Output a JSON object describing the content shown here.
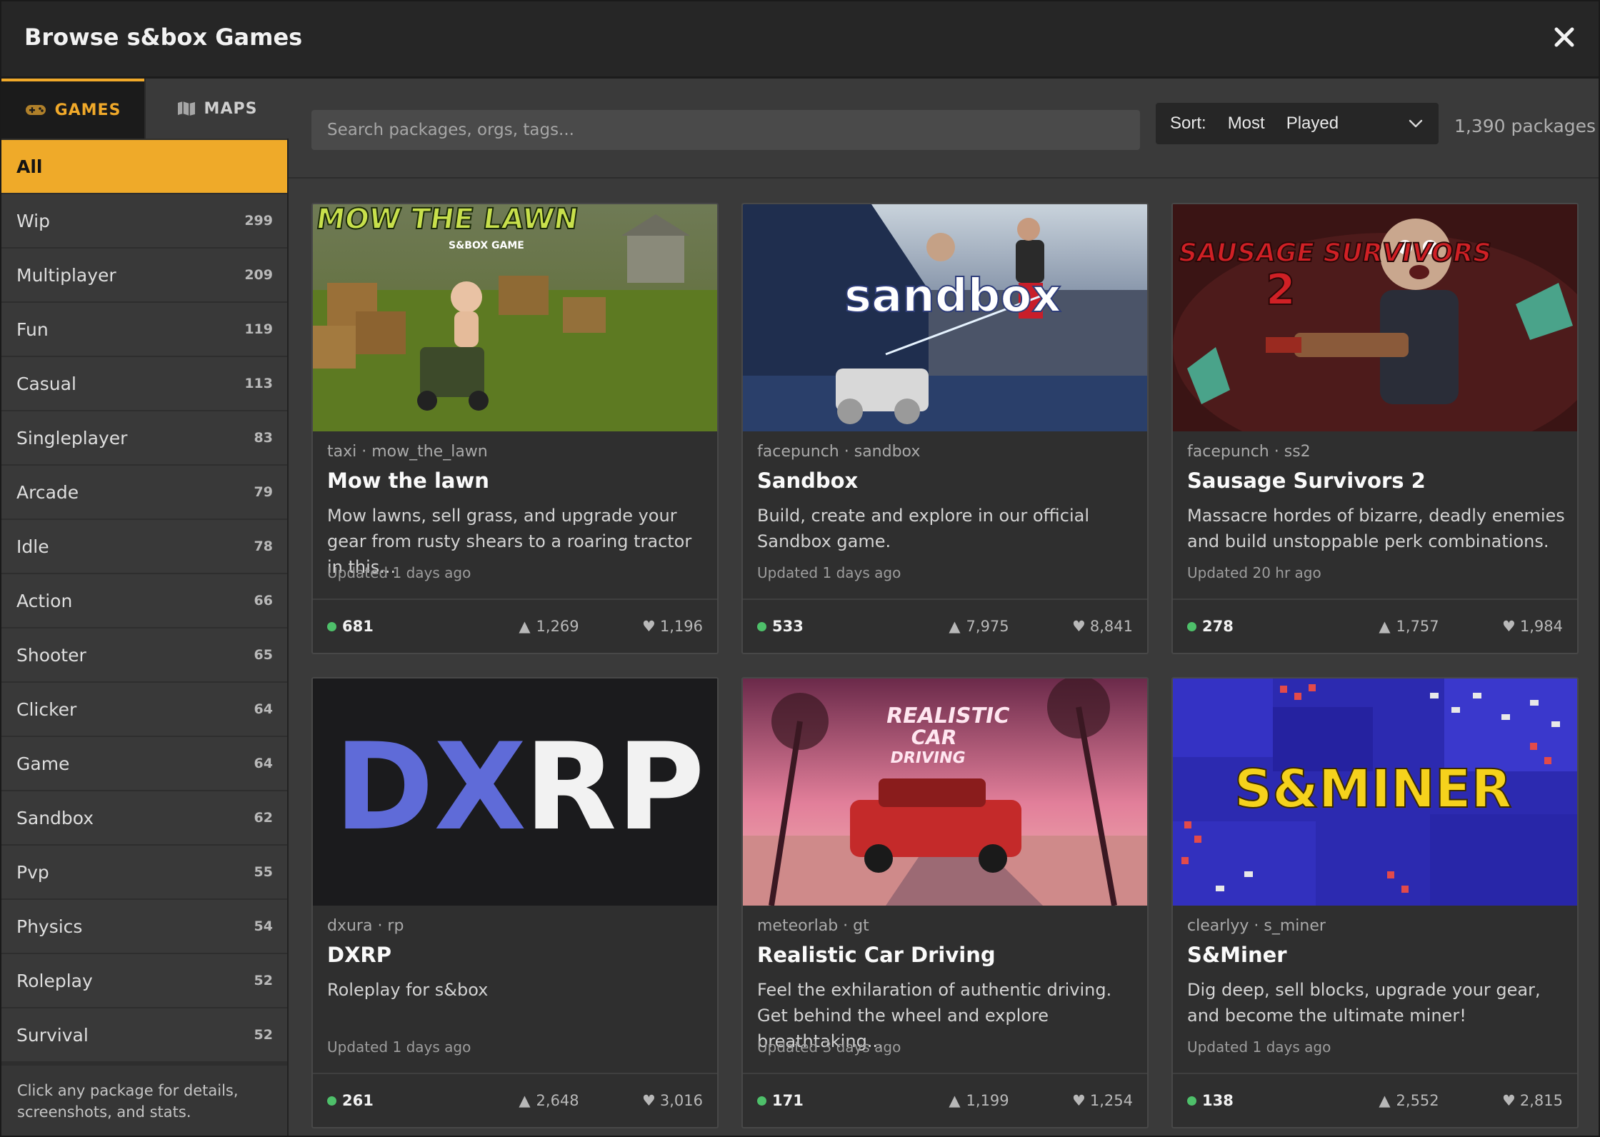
{
  "window": {
    "title": "Browse s&box Games"
  },
  "tabs": [
    {
      "label": "GAMES",
      "icon": "gamepad-icon"
    },
    {
      "label": "MAPS",
      "icon": "map-icon"
    }
  ],
  "categories": [
    {
      "label": "All",
      "count": ""
    },
    {
      "label": "Wip",
      "count": "299"
    },
    {
      "label": "Multiplayer",
      "count": "209"
    },
    {
      "label": "Fun",
      "count": "119"
    },
    {
      "label": "Casual",
      "count": "113"
    },
    {
      "label": "Singleplayer",
      "count": "83"
    },
    {
      "label": "Arcade",
      "count": "79"
    },
    {
      "label": "Idle",
      "count": "78"
    },
    {
      "label": "Action",
      "count": "66"
    },
    {
      "label": "Shooter",
      "count": "65"
    },
    {
      "label": "Clicker",
      "count": "64"
    },
    {
      "label": "Game",
      "count": "64"
    },
    {
      "label": "Sandbox",
      "count": "62"
    },
    {
      "label": "Pvp",
      "count": "55"
    },
    {
      "label": "Physics",
      "count": "54"
    },
    {
      "label": "Roleplay",
      "count": "52"
    },
    {
      "label": "Survival",
      "count": "52"
    }
  ],
  "sidebar_hint": "Click any package for details, screenshots, and stats.",
  "search": {
    "placeholder": "Search packages, orgs, tags...",
    "value": ""
  },
  "sort": {
    "label": "Sort:",
    "value_word1": "Most",
    "value_word2": "Played"
  },
  "package_count": "1,390 packages",
  "cards": [
    {
      "meta": "taxi · mow_the_lawn",
      "title": "Mow the lawn",
      "desc": "Mow lawns, sell grass, and upgrade your gear from rusty shears to a roaring tractor in this...",
      "updated": "Updated 1 days ago",
      "online": "681",
      "upvotes": "1,269",
      "favourites": "1,196",
      "art_title": "MOW THE LAWN",
      "art_sub": "S&BOX GAME"
    },
    {
      "meta": "facepunch · sandbox",
      "title": "Sandbox",
      "desc": "Build, create and explore in our official Sandbox game.",
      "updated": "Updated 1 days ago",
      "online": "533",
      "upvotes": "7,975",
      "favourites": "8,841",
      "art_title": "sandbox"
    },
    {
      "meta": "facepunch · ss2",
      "title": "Sausage Survivors 2",
      "desc": "Massacre hordes of bizarre, deadly enemies and build unstoppable perk combinations.",
      "updated": "Updated 20 hr ago",
      "online": "278",
      "upvotes": "1,757",
      "favourites": "1,984",
      "art_title": "SAUSAGE SURVIVORS",
      "art_sub": "2"
    },
    {
      "meta": "dxura · rp",
      "title": "DXRP",
      "desc": "Roleplay for s&box",
      "updated": "Updated 1 days ago",
      "online": "261",
      "upvotes": "2,648",
      "favourites": "3,016",
      "art_title_a": "DX",
      "art_title_b": "RP"
    },
    {
      "meta": "meteorlab · gt",
      "title": "Realistic Car Driving",
      "desc": "Feel the exhilaration of authentic driving. Get behind the wheel and explore breathtaking...",
      "updated": "Updated 3 days ago",
      "online": "171",
      "upvotes": "1,199",
      "favourites": "1,254",
      "art_title": "REALISTIC",
      "art_title2": "CAR",
      "art_title3": "DRIVING"
    },
    {
      "meta": "clearlyy · s_miner",
      "title": "S&Miner",
      "desc": "Dig deep, sell blocks, upgrade your gear, and become the ultimate miner!",
      "updated": "Updated 1 days ago",
      "online": "138",
      "upvotes": "2,552",
      "favourites": "2,815",
      "art_title": "S&MINER"
    }
  ],
  "colors": {
    "accent": "#efaa29",
    "online": "#4ec06a",
    "dxrp_blue": "#5f6bd8"
  }
}
